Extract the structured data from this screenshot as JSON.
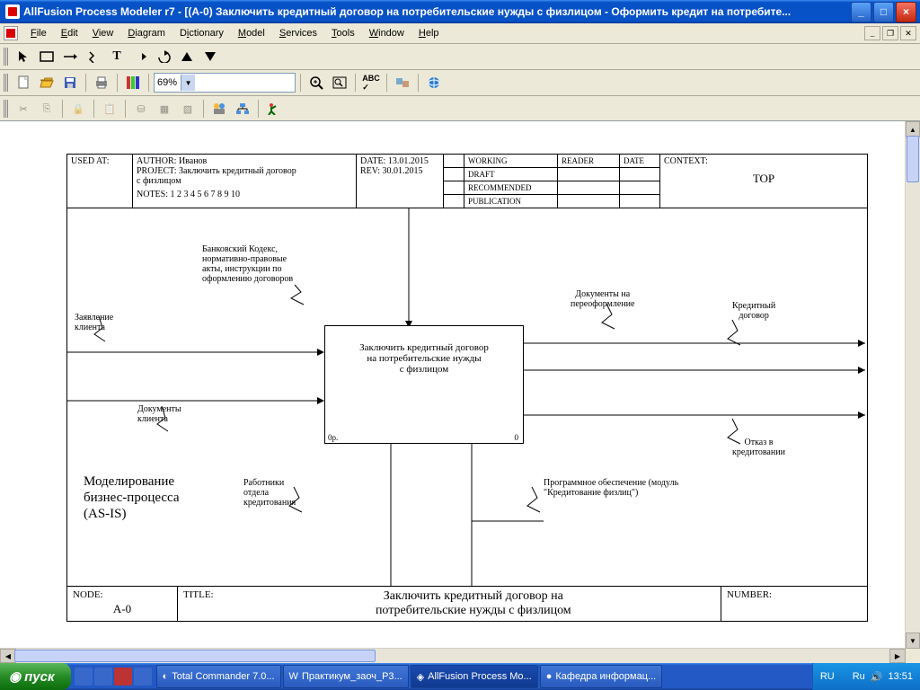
{
  "title": "AllFusion Process Modeler r7 - [(A-0) Заключить кредитный договор  на потребительские  нужды  с физлицом - Оформить кредит на потребите...",
  "menu": [
    "File",
    "Edit",
    "View",
    "Diagram",
    "Dictionary",
    "Model",
    "Services",
    "Tools",
    "Window",
    "Help"
  ],
  "zoom": "69%",
  "header": {
    "used_at": "USED AT:",
    "author": "AUTHOR:  Иванов",
    "project": "PROJECT:  Заключить кредитный договор",
    "project2": "с физлицом",
    "notes": "NOTES:  1 2 3 4 5 6 7 8 9 10",
    "date": "DATE: 13.01.2015",
    "rev": "REV:   30.01.2015",
    "status": [
      "WORKING",
      "DRAFT",
      "RECOMMENDED",
      "PUBLICATION"
    ],
    "reader": "READER",
    "date2": "DATE",
    "context": "CONTEXT:",
    "top": "TOP"
  },
  "diagram": {
    "activity": "Заключить кредитный договор\nна потребительские нужды\nс физлицом",
    "cost": "0р.",
    "num": "0",
    "inputs": [
      "Заявление\nклиента",
      "Документы\nклиента"
    ],
    "control": "Банковский Кодекс,\nнормативно-правовые\nакты, инструкции по\nоформлению договоров",
    "outputs": [
      "Документы на\nпереоформление",
      "Кредитный\nдоговор",
      "Отказ в\nкредитовании"
    ],
    "mechanisms": [
      "Работники\nотдела\nкредитования",
      "Программное обеспечение (модуль\n\"Кредитование физлиц\")"
    ],
    "caption": "Моделирование\nбизнес-процесса\n(AS-IS)"
  },
  "footer": {
    "node_lbl": "NODE:",
    "node": "A-0",
    "title_lbl": "TITLE:",
    "title": "Заключить кредитный договор  на\nпотребительские нужды  с физлицом",
    "number_lbl": "NUMBER:"
  },
  "taskbar": {
    "start": "пуск",
    "items": [
      "Total Commander 7.0...",
      "Практикум_заоч_Р3...",
      "AllFusion Process Mo...",
      "Кафедра информац..."
    ],
    "lang": "RU",
    "lang2": "Ru",
    "time": "13:51"
  }
}
